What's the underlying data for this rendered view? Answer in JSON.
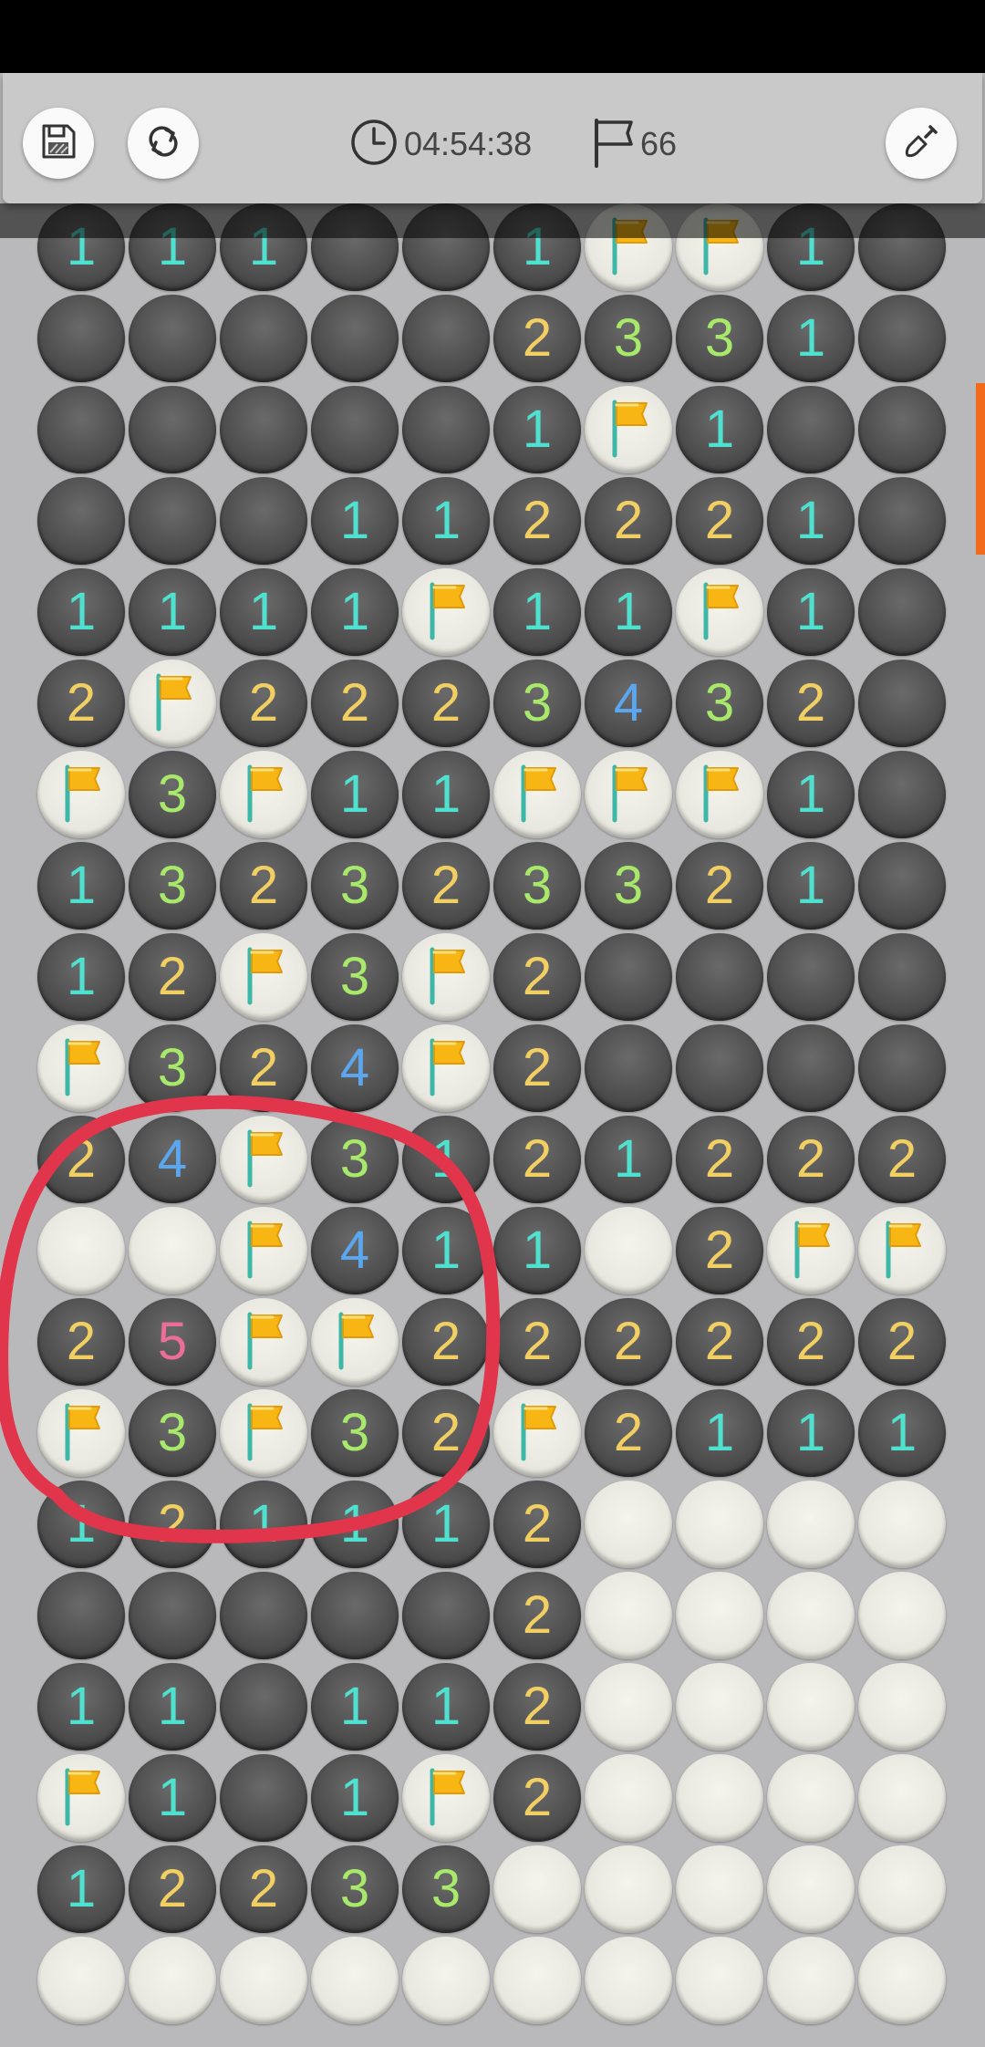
{
  "toolbar": {
    "timer": "04:54:38",
    "flags_remaining": "66",
    "icons": {
      "save": "floppy-disk-icon",
      "restart": "refresh-icon",
      "timer": "clock-icon",
      "flags": "flag-outline-icon",
      "mode": "shovel-icon"
    }
  },
  "colors": {
    "accent": "#f26b1d",
    "annotation": "#e0354a",
    "number_1": "#4fe0cf",
    "number_2": "#f1cf62",
    "number_3": "#a8e86a",
    "number_4": "#5aa7f0",
    "number_5": "#ec6d99"
  },
  "board": {
    "columns": 10,
    "legend": "digit = revealed count, . = revealed empty, F = flag, # = unrevealed",
    "rows": [
      "111..1FF1.",
      ".....2331.",
      ".....1F1..",
      "...112221.",
      "1111F11F1.",
      "2F2223432.",
      "F3F11FFF1.",
      "132323321.",
      "12F3F2....",
      "F324F2....",
      "24F3121222",
      "##F411#2FF",
      "25FF222222",
      "F3F32F2111",
      "121112####",
      ".....2####",
      "11.112####",
      "F1.1F2####",
      "12233#####",
      "##########"
    ]
  },
  "annotation": {
    "shape": "hand-drawn-circle",
    "color": "#e0354a"
  }
}
